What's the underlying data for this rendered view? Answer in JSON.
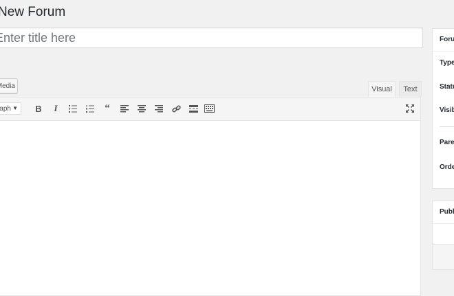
{
  "page": {
    "title": "New Forum"
  },
  "title_field": {
    "placeholder": "Enter title here"
  },
  "editor": {
    "media_button_label": "Add Media",
    "tabs": {
      "visual": "Visual",
      "text": "Text"
    },
    "format_select_value": "Paragraph",
    "toolbar_icons": [
      "bold-icon",
      "italic-icon",
      "bulleted-list-icon",
      "numbered-list-icon",
      "blockquote-icon",
      "align-left-icon",
      "align-center-icon",
      "align-right-icon",
      "link-icon",
      "read-more-icon",
      "toolbar-toggle-icon",
      "fullscreen-icon"
    ]
  },
  "sidebar": {
    "forum_box": {
      "heading": "Forum Attributes",
      "type_label": "Type:",
      "status_label": "Status:",
      "visibility_label": "Visibility:",
      "parent_label": "Parent:",
      "order_label": "Order:"
    },
    "publish_box": {
      "heading": "Publish"
    }
  }
}
